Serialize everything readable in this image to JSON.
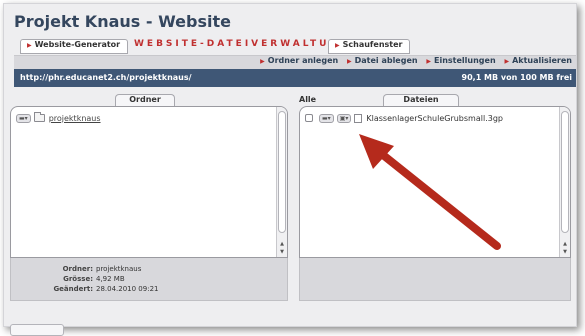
{
  "title": "Projekt Knaus - Website",
  "tabs": {
    "generator": "Website-Generator",
    "active": "WEBSITE-DATEIVERWALTUNG",
    "showcase": "Schaufenster"
  },
  "toolbar": {
    "create_folder": "Ordner anlegen",
    "store_file": "Datei ablegen",
    "settings": "Einstellungen",
    "refresh": "Aktualisieren"
  },
  "pathbar": {
    "url": "http://phr.educanet2.ch/projektknaus/",
    "quota": "90,1 MB von 100 MB frei"
  },
  "folders_panel": {
    "tab_label": "Ordner",
    "items": [
      {
        "name": "projektknaus"
      }
    ],
    "info": {
      "folder_label": "Ordner:",
      "folder_value": "projektknaus",
      "size_label": "Grösse:",
      "size_value": "4,92 MB",
      "modified_label": "Geändert:",
      "modified_value": "28.04.2010 09:21"
    }
  },
  "files_panel": {
    "all_label": "Alle",
    "tab_label": "Dateien",
    "items": [
      {
        "name": "KlassenlagerSchuleGrubsmall.3gp"
      }
    ]
  },
  "colors": {
    "title": "#34465e",
    "accent": "#c03030",
    "pathbar_bg": "#3f5776",
    "annotation_arrow": "#b52a1c"
  },
  "icons": [
    "folder-icon",
    "file-icon",
    "checkbox-icon",
    "annotation-arrow-icon"
  ]
}
